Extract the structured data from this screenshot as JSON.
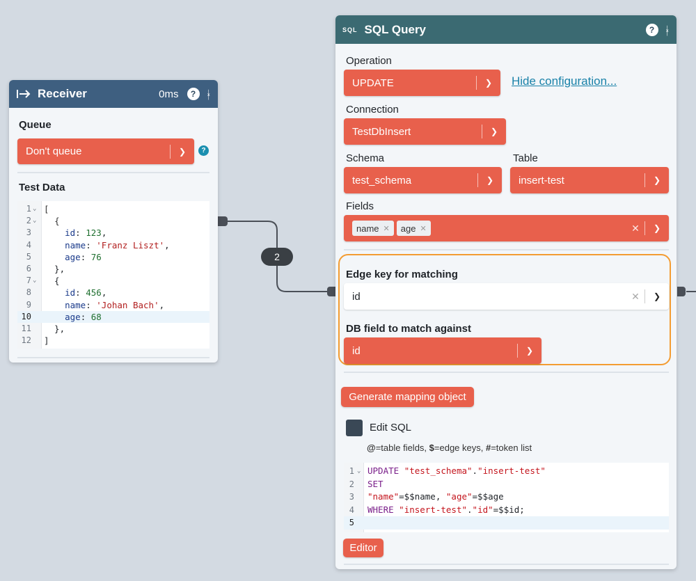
{
  "receiver": {
    "title": "Receiver",
    "timing": "0ms",
    "queue_label": "Queue",
    "queue_value": "Don't queue",
    "test_data_label": "Test Data",
    "code_lines": [
      {
        "n": "1",
        "fold": true,
        "html": "<span class='p'>[</span>"
      },
      {
        "n": "2",
        "fold": true,
        "html": "  <span class='p'>{</span>"
      },
      {
        "n": "3",
        "fold": false,
        "html": "    <span class='k'>id</span>: <span class='n'>123</span>,"
      },
      {
        "n": "4",
        "fold": false,
        "html": "    <span class='k'>name</span>: <span class='s'>'Franz Liszt'</span>,"
      },
      {
        "n": "5",
        "fold": false,
        "html": "    <span class='k'>age</span>: <span class='n'>76</span>"
      },
      {
        "n": "6",
        "fold": false,
        "html": "  },"
      },
      {
        "n": "7",
        "fold": true,
        "html": "  {"
      },
      {
        "n": "8",
        "fold": false,
        "html": "    <span class='k'>id</span>: <span class='n'>456</span>,"
      },
      {
        "n": "9",
        "fold": false,
        "html": "    <span class='k'>name</span>: <span class='s'>'Johan Bach'</span>,"
      },
      {
        "n": "10",
        "fold": false,
        "html": "    <span class='k'>age</span>: <span class='n'>68</span>"
      },
      {
        "n": "11",
        "fold": false,
        "html": "  },"
      },
      {
        "n": "12",
        "fold": false,
        "html": "]"
      }
    ]
  },
  "edge": {
    "count": "2"
  },
  "sql": {
    "title": "SQL Query",
    "operation_label": "Operation",
    "operation_value": "UPDATE",
    "hide_config_link": "Hide configuration...",
    "connection_label": "Connection",
    "connection_value": "TestDbInsert",
    "schema_label": "Schema",
    "schema_value": "test_schema",
    "table_label": "Table",
    "table_value": "insert-test",
    "fields_label": "Fields",
    "fields": [
      "name",
      "age"
    ],
    "edge_key_label": "Edge key for matching",
    "edge_key_value": "id",
    "db_field_label": "DB field to match against",
    "db_field_value": "id",
    "generate_button": "Generate mapping object",
    "edit_sql_label": "Edit SQL",
    "hint": "<b>@</b>=table fields, <b>$</b>=edge keys, <b>#</b>=token list",
    "sql_lines": [
      {
        "n": "1",
        "fold": true,
        "html": "<span class='sql-kw'>UPDATE</span> <span class='sql-s'>\"test_schema\"</span>.<span class='sql-s'>\"insert-test\"</span>"
      },
      {
        "n": "2",
        "fold": false,
        "html": "<span class='sql-kw'>SET</span>"
      },
      {
        "n": "3",
        "fold": false,
        "html": "<span class='sql-s'>\"name\"</span>=$$name, <span class='sql-s'>\"age\"</span>=$$age"
      },
      {
        "n": "4",
        "fold": false,
        "html": "<span class='sql-kw'>WHERE</span> <span class='sql-s'>\"insert-test\"</span>.<span class='sql-s'>\"id\"</span>=$$id;"
      },
      {
        "n": "5",
        "fold": false,
        "html": ""
      }
    ],
    "editor_button": "Editor"
  },
  "colors": {
    "receiver_header": "#3e5f80",
    "sql_header": "#3b6a72",
    "accent": "#e8604c",
    "highlight_border": "#f39c32"
  }
}
